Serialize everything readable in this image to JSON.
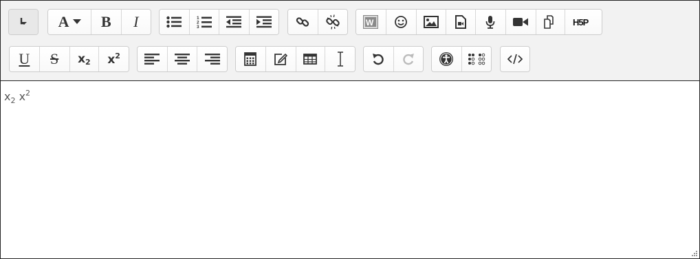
{
  "toolbar": {
    "row1": [
      {
        "group": "toggle",
        "buttons": [
          {
            "name": "show-more-buttons",
            "icon": "collapse-arrow-icon"
          }
        ]
      },
      {
        "group": "style",
        "buttons": [
          {
            "name": "paragraph-styles",
            "label": "A",
            "icon": "font-style-dropdown-icon"
          },
          {
            "name": "bold",
            "label": "B"
          },
          {
            "name": "italic",
            "label": "I"
          }
        ]
      },
      {
        "group": "list",
        "buttons": [
          {
            "name": "unordered-list",
            "icon": "bullet-list-icon"
          },
          {
            "name": "ordered-list",
            "icon": "numbered-list-icon",
            "digits": [
              "1",
              "2",
              "3"
            ]
          },
          {
            "name": "outdent",
            "icon": "outdent-icon"
          },
          {
            "name": "indent",
            "icon": "indent-icon"
          }
        ]
      },
      {
        "group": "links",
        "buttons": [
          {
            "name": "link",
            "icon": "link-icon"
          },
          {
            "name": "unlink",
            "icon": "unlink-icon"
          }
        ]
      },
      {
        "group": "files",
        "buttons": [
          {
            "name": "word-import",
            "icon": "word-import-icon",
            "label": "W"
          },
          {
            "name": "emoticon",
            "icon": "smiley-icon"
          },
          {
            "name": "image",
            "icon": "image-icon"
          },
          {
            "name": "media",
            "icon": "media-file-icon"
          },
          {
            "name": "record-audio",
            "icon": "microphone-icon"
          },
          {
            "name": "record-video",
            "icon": "video-camera-icon"
          },
          {
            "name": "manage-files",
            "icon": "copy-files-icon"
          },
          {
            "name": "h5p",
            "icon": "h5p-icon",
            "label": "H5P"
          }
        ]
      }
    ],
    "row2": [
      {
        "group": "style2",
        "buttons": [
          {
            "name": "underline",
            "label": "U"
          },
          {
            "name": "strikethrough",
            "label": "S"
          },
          {
            "name": "subscript",
            "label": "x",
            "small": "2"
          },
          {
            "name": "superscript",
            "label": "x",
            "small": "2"
          }
        ]
      },
      {
        "group": "align",
        "buttons": [
          {
            "name": "align-left",
            "icon": "align-left-icon"
          },
          {
            "name": "align-center",
            "icon": "align-center-icon"
          },
          {
            "name": "align-right",
            "icon": "align-right-icon"
          }
        ]
      },
      {
        "group": "insert",
        "buttons": [
          {
            "name": "equation",
            "icon": "calculator-icon"
          },
          {
            "name": "special-character",
            "icon": "edit-pencil-icon"
          },
          {
            "name": "table",
            "icon": "table-icon"
          },
          {
            "name": "clear-formatting",
            "icon": "text-cursor-icon"
          }
        ]
      },
      {
        "group": "undo",
        "buttons": [
          {
            "name": "undo",
            "icon": "undo-icon"
          },
          {
            "name": "redo",
            "icon": "redo-icon",
            "disabled": true
          }
        ]
      },
      {
        "group": "accessibility",
        "buttons": [
          {
            "name": "accessibility-checker",
            "icon": "accessibility-icon"
          },
          {
            "name": "screenreader-helper",
            "icon": "braille-icon"
          }
        ]
      },
      {
        "group": "other",
        "buttons": [
          {
            "name": "html-source",
            "icon": "code-icon"
          }
        ]
      }
    ]
  },
  "content": {
    "sub_base": "x",
    "sub_small": "2",
    "sup_base": "x",
    "sup_small": "2"
  }
}
